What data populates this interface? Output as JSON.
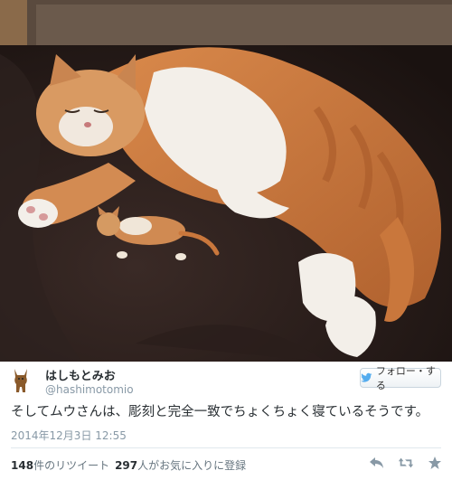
{
  "tweet": {
    "display_name": "はしもとみお",
    "screen_name": "@hashimotomio",
    "follow_label": "フォロー・する",
    "text": "そしてムウさんは、彫刻と完全一致でちょくちょく寝ているそうです。",
    "date": "2014年12月3日 12:55",
    "retweet_count": "148",
    "retweet_suffix": "件のリツイート",
    "favorite_count": "297",
    "favorite_suffix": "人がお気に入りに登録"
  },
  "icons": {
    "follow": "twitter-bird-icon",
    "reply": "reply-icon",
    "retweet": "retweet-icon",
    "favorite": "star-icon"
  },
  "colors": {
    "twitter_blue": "#55acee",
    "action_gray": "#8899a6"
  }
}
